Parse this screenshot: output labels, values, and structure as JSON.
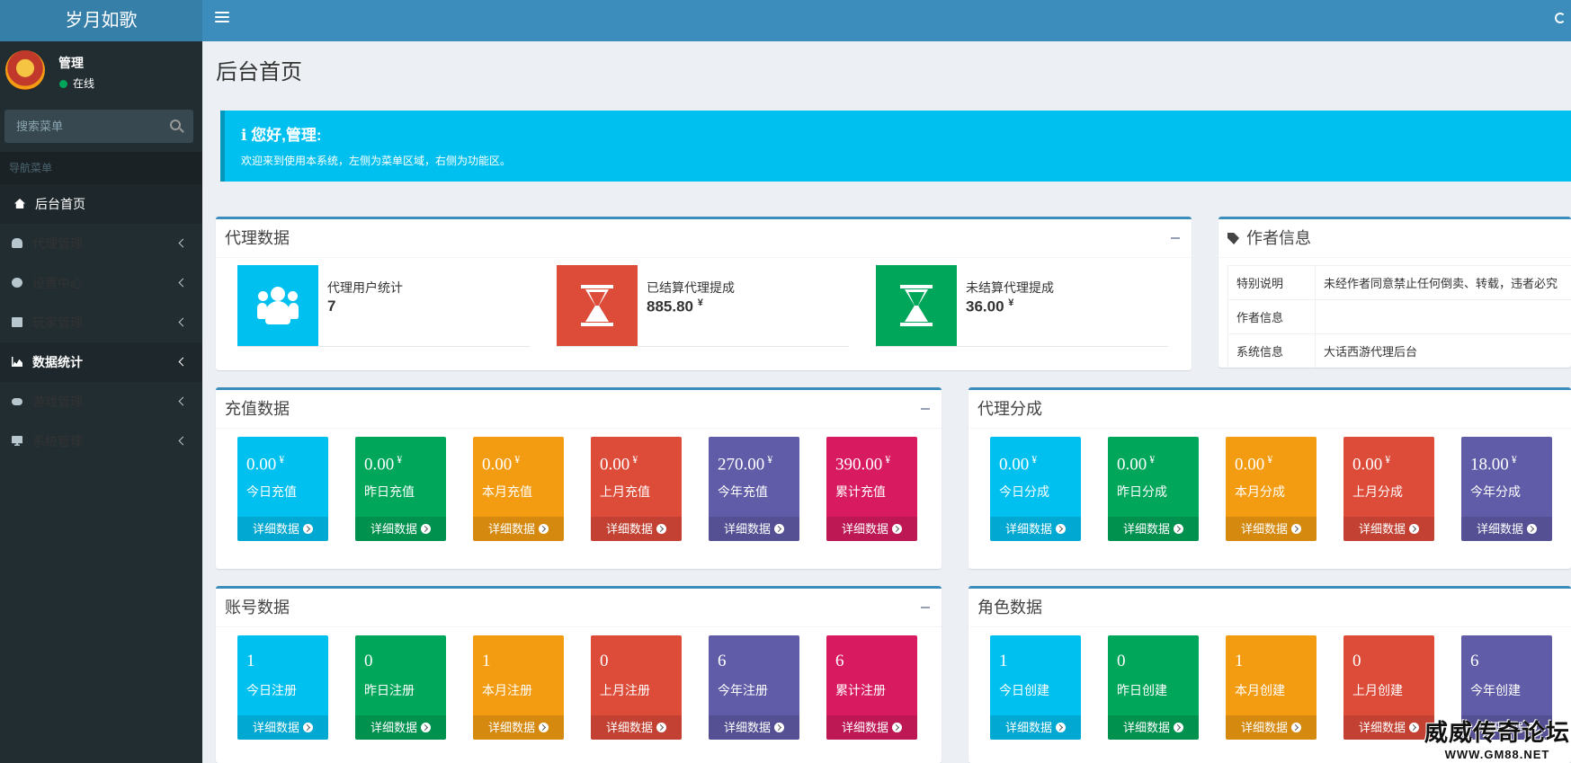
{
  "app": {
    "title": "岁月如歌"
  },
  "user": {
    "name": "管理",
    "status": "在线"
  },
  "search": {
    "placeholder": "搜索菜单"
  },
  "nav": {
    "header": "导航菜单",
    "items": [
      {
        "label": "后台首页",
        "icon": "home-icon"
      },
      {
        "label": "代理管理",
        "icon": "users-icon"
      },
      {
        "label": "设置中心",
        "icon": "gears-icon"
      },
      {
        "label": "玩家管理",
        "icon": "address-book-icon"
      },
      {
        "label": "数据统计",
        "icon": "area-chart-icon"
      },
      {
        "label": "游戏管理",
        "icon": "gamepad-icon"
      },
      {
        "label": "系统管理",
        "icon": "desktop-icon"
      }
    ]
  },
  "page": {
    "title": "后台首页"
  },
  "callout": {
    "title": "您好,管理:",
    "message": "欢迎来到使用本系统，左侧为菜单区域，右侧为功能区。"
  },
  "agent_box": {
    "title": "代理数据",
    "items": [
      {
        "label": "代理用户统计",
        "value": "7",
        "unit": "",
        "color": "#00c0ef",
        "icon": "users-icon"
      },
      {
        "label": "已结算代理提成",
        "value": "885.80",
        "unit": "¥",
        "color": "#dd4b39",
        "icon": "hourglass-icon"
      },
      {
        "label": "未结算代理提成",
        "value": "36.00",
        "unit": "¥",
        "color": "#00a65a",
        "icon": "hourglass-icon"
      }
    ]
  },
  "author_box": {
    "title": "作者信息",
    "rows": [
      {
        "key": "特别说明",
        "value": "未经作者同意禁止任何倒卖、转载，违者必究"
      },
      {
        "key": "作者信息",
        "value": ""
      },
      {
        "key": "系统信息",
        "value": "大话西游代理后台"
      }
    ]
  },
  "footer_link": "详细数据",
  "recharge_box": {
    "title": "充值数据",
    "tiles": [
      {
        "value": "0.00",
        "unit": "¥",
        "label": "今日充值",
        "color": "#00c0ef"
      },
      {
        "value": "0.00",
        "unit": "¥",
        "label": "昨日充值",
        "color": "#00a65a"
      },
      {
        "value": "0.00",
        "unit": "¥",
        "label": "本月充值",
        "color": "#f39c12"
      },
      {
        "value": "0.00",
        "unit": "¥",
        "label": "上月充值",
        "color": "#dd4b39"
      },
      {
        "value": "270.00",
        "unit": "¥",
        "label": "今年充值",
        "color": "#605ca8"
      },
      {
        "value": "390.00",
        "unit": "¥",
        "label": "累计充值",
        "color": "#d81b60"
      }
    ]
  },
  "commission_box": {
    "title": "代理分成",
    "tiles": [
      {
        "value": "0.00",
        "unit": "¥",
        "label": "今日分成",
        "color": "#00c0ef"
      },
      {
        "value": "0.00",
        "unit": "¥",
        "label": "昨日分成",
        "color": "#00a65a"
      },
      {
        "value": "0.00",
        "unit": "¥",
        "label": "本月分成",
        "color": "#f39c12"
      },
      {
        "value": "0.00",
        "unit": "¥",
        "label": "上月分成",
        "color": "#dd4b39"
      },
      {
        "value": "18.00",
        "unit": "¥",
        "label": "今年分成",
        "color": "#605ca8"
      }
    ]
  },
  "account_box": {
    "title": "账号数据",
    "tiles": [
      {
        "value": "1",
        "unit": "",
        "label": "今日注册",
        "color": "#00c0ef"
      },
      {
        "value": "0",
        "unit": "",
        "label": "昨日注册",
        "color": "#00a65a"
      },
      {
        "value": "1",
        "unit": "",
        "label": "本月注册",
        "color": "#f39c12"
      },
      {
        "value": "0",
        "unit": "",
        "label": "上月注册",
        "color": "#dd4b39"
      },
      {
        "value": "6",
        "unit": "",
        "label": "今年注册",
        "color": "#605ca8"
      },
      {
        "value": "6",
        "unit": "",
        "label": "累计注册",
        "color": "#d81b60"
      }
    ]
  },
  "role_box": {
    "title": "角色数据",
    "tiles": [
      {
        "value": "1",
        "unit": "",
        "label": "今日创建",
        "color": "#00c0ef"
      },
      {
        "value": "0",
        "unit": "",
        "label": "昨日创建",
        "color": "#00a65a"
      },
      {
        "value": "1",
        "unit": "",
        "label": "本月创建",
        "color": "#f39c12"
      },
      {
        "value": "0",
        "unit": "",
        "label": "上月创建",
        "color": "#dd4b39"
      },
      {
        "value": "6",
        "unit": "",
        "label": "今年创建",
        "color": "#605ca8"
      }
    ]
  },
  "watermark": {
    "line1": "威威传奇论坛",
    "line2": "WWW.GM88.NET"
  }
}
